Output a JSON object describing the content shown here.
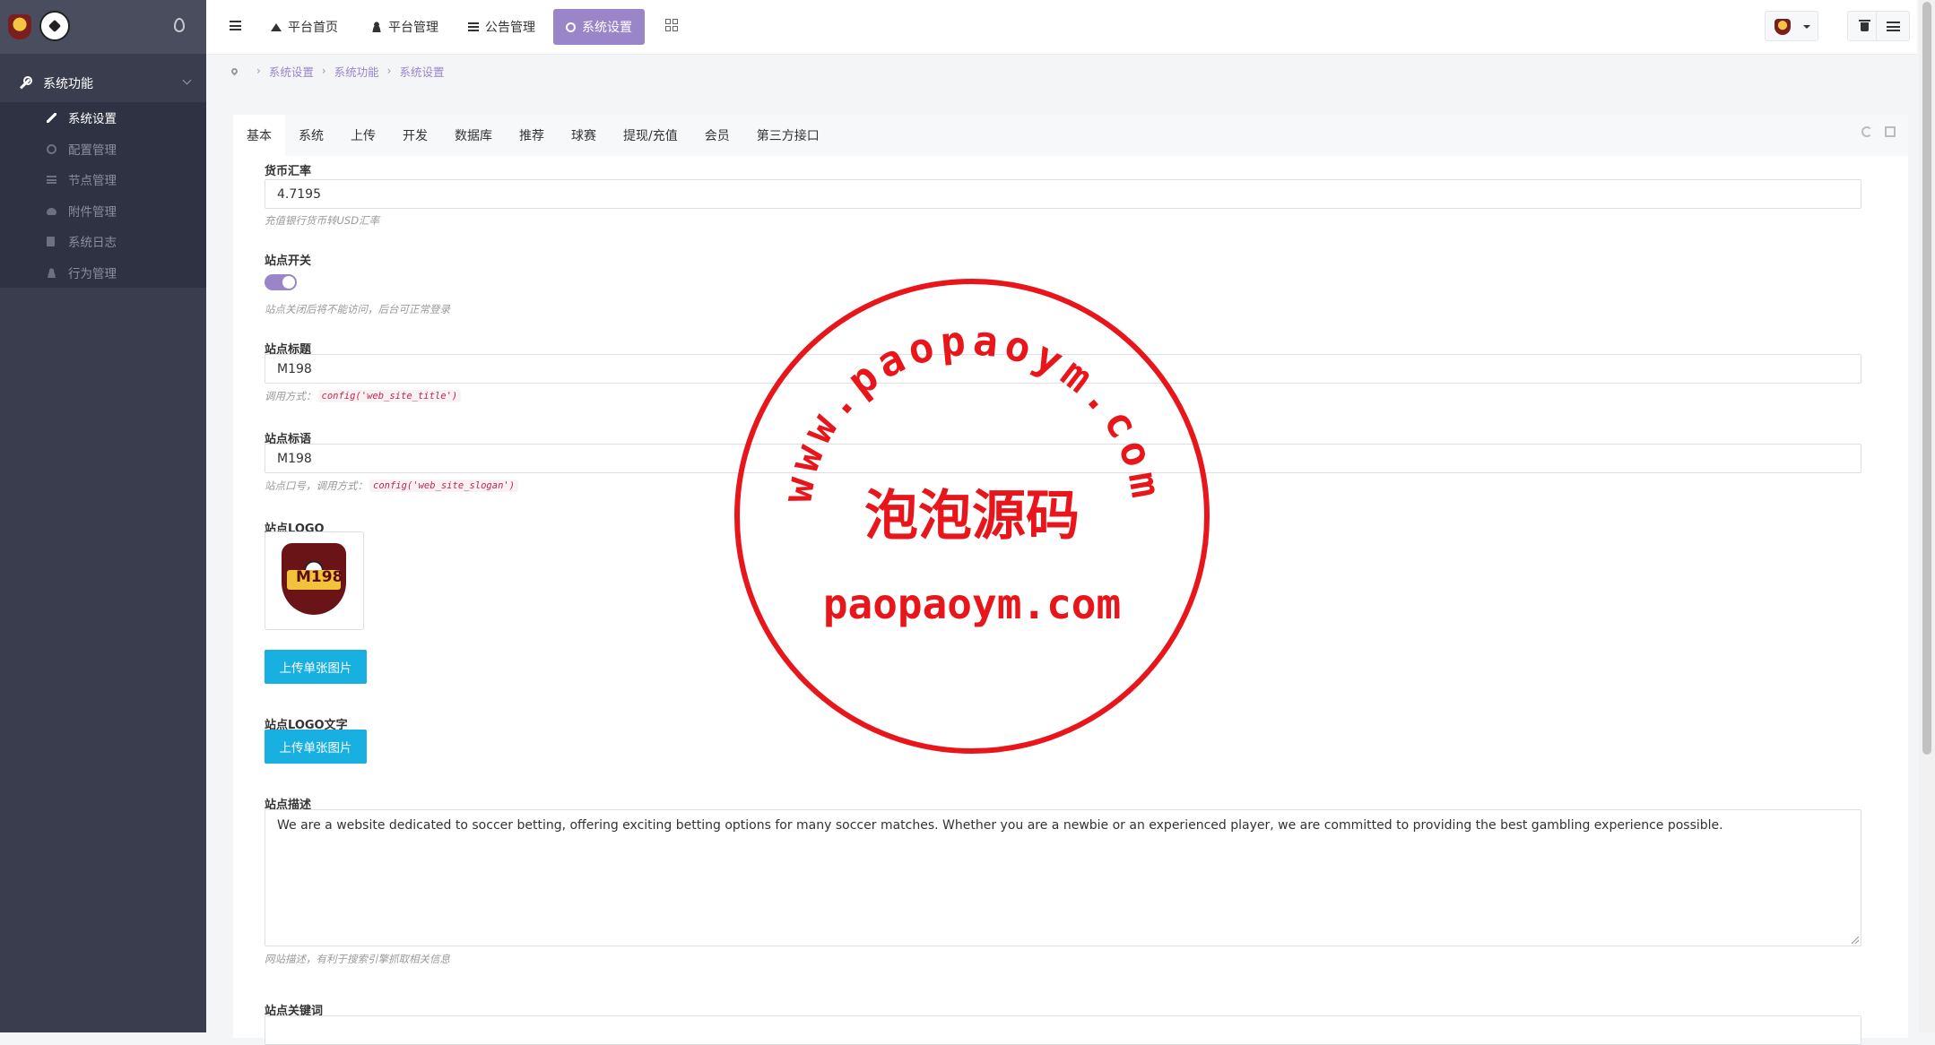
{
  "topnav": {
    "items": [
      {
        "label": "平台首页",
        "icon": "home-icon"
      },
      {
        "label": "平台管理",
        "icon": "user-icon"
      },
      {
        "label": "公告管理",
        "icon": "list-icon"
      },
      {
        "label": "系统设置",
        "icon": "gear-icon"
      }
    ],
    "active_color": "#9b85c9"
  },
  "sidebar": {
    "group_label": "系统功能",
    "items": [
      {
        "label": "系统设置",
        "icon": "wrench-icon",
        "active": true
      },
      {
        "label": "配置管理",
        "icon": "gears-icon"
      },
      {
        "label": "节点管理",
        "icon": "list-icon"
      },
      {
        "label": "附件管理",
        "icon": "cloud-icon"
      },
      {
        "label": "系统日志",
        "icon": "book-icon"
      },
      {
        "label": "行为管理",
        "icon": "user-icon"
      }
    ]
  },
  "breadcrumb": [
    "系统设置",
    "系统功能",
    "系统设置"
  ],
  "tabs": [
    "基本",
    "系统",
    "上传",
    "开发",
    "数据库",
    "推荐",
    "球赛",
    "提现/充值",
    "会员",
    "第三方接口"
  ],
  "form": {
    "rate_label": "货币汇率",
    "rate_value": "4.7195",
    "rate_help": "充值银行货币转USD汇率",
    "switch_label": "站点开关",
    "switch_on": true,
    "switch_help": "站点关闭后将不能访问，后台可正常登录",
    "title_label": "站点标题",
    "title_value": "M198",
    "title_help_prefix": "调用方式：",
    "title_help_code": "config('web_site_title')",
    "slogan_label": "站点标语",
    "slogan_value": "M198",
    "slogan_help_prefix": "站点口号，调用方式：",
    "slogan_help_code": "config('web_site_slogan')",
    "logo_label": "站点LOGO",
    "logo_text": "M198",
    "upload_label": "上传单张图片",
    "logo_text_label": "站点LOGO文字",
    "upload_label_2": "上传单张图片",
    "desc_label": "站点描述",
    "desc_value": "We are a website dedicated to soccer betting, offering exciting betting options for many soccer matches. Whether you are a newbie or an experienced player, we are committed to providing the best gambling experience possible.",
    "desc_help": "网站描述，有利于搜索引擎抓取相关信息",
    "keywords_label": "站点关键词"
  },
  "watermark": {
    "ring_text": "www.paopaoym.com",
    "center_text": "泡泡源码",
    "bottom_text": "paopaoym.com",
    "color": "#e8161b"
  }
}
